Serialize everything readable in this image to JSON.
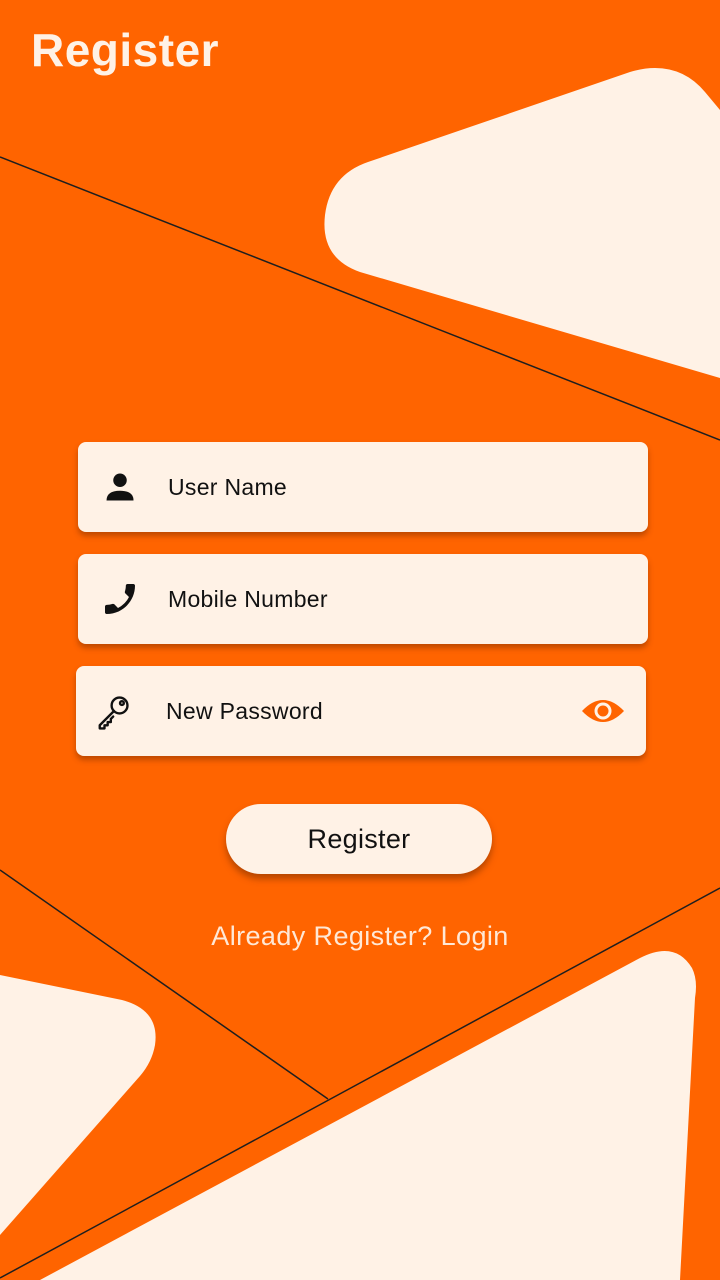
{
  "header": {
    "title": "Register"
  },
  "form": {
    "username": {
      "placeholder": "User Name",
      "icon": "person-icon"
    },
    "mobile": {
      "placeholder": "Mobile Number",
      "icon": "phone-icon"
    },
    "password": {
      "placeholder": "New Password",
      "icon": "key-icon",
      "toggle_icon": "eye-icon"
    }
  },
  "actions": {
    "register_label": "Register",
    "login_prompt": "Already Register?",
    "login_label": "Login"
  },
  "colors": {
    "background": "#FF6400",
    "surface": "#FFF2E6",
    "accent": "#FF6400"
  }
}
